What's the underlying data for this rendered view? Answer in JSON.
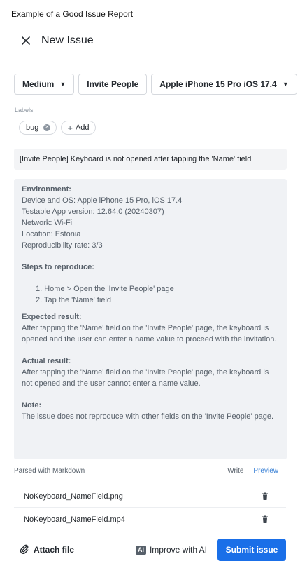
{
  "caption": "Example of a Good Issue Report",
  "header": {
    "title": "New Issue",
    "close_icon": "close-icon"
  },
  "toolbar": {
    "priority": "Medium",
    "area": "Invite People",
    "device": "Apple iPhone 15 Pro iOS 17.4"
  },
  "labels": {
    "caption": "Labels",
    "items": [
      {
        "label": "bug"
      }
    ],
    "add_label": "Add"
  },
  "issue": {
    "title": "[Invite People] Keyboard is not opened after tapping the 'Name' field",
    "body": {
      "environment_heading": "Environment:",
      "environment_lines": [
        "Device and OS: Apple iPhone 15 Pro, iOS 17.4",
        "Testable App version: 12.64.0 (20240307)",
        "Network: Wi-Fi",
        "Location: Estonia",
        "Reproducibility rate: 3/3"
      ],
      "steps_heading": "Steps to reproduce:",
      "steps": [
        "1. Home > Open the 'Invite People' page",
        "2. Tap the 'Name' field"
      ],
      "expected_heading": "Expected result:",
      "expected_text": "After tapping the 'Name' field on the 'Invite People' page, the keyboard is opened and the user can enter a name value to proceed with the invitation.",
      "actual_heading": "Actual result:",
      "actual_text": "After tapping the 'Name' field on the 'Invite People' page, the keyboard is not opened and the user cannot enter a name value.",
      "note_heading": "Note:",
      "note_text": "The issue does not reproduce with other fields on the 'Invite People' page."
    }
  },
  "markdown": {
    "label": "Parsed with Markdown",
    "write_tab": "Write",
    "preview_tab": "Preview"
  },
  "attachments": [
    {
      "name": "NoKeyboard_NameField.png"
    },
    {
      "name": "NoKeyboard_NameField.mp4"
    }
  ],
  "footer": {
    "attach_label": "Attach file",
    "ai_badge": "AI",
    "ai_label": "Improve with AI",
    "submit_label": "Submit issue"
  },
  "colors": {
    "accent": "#1a6fe8",
    "preview_tab": "#3b82d6",
    "body_bg": "#f0f2f5"
  }
}
